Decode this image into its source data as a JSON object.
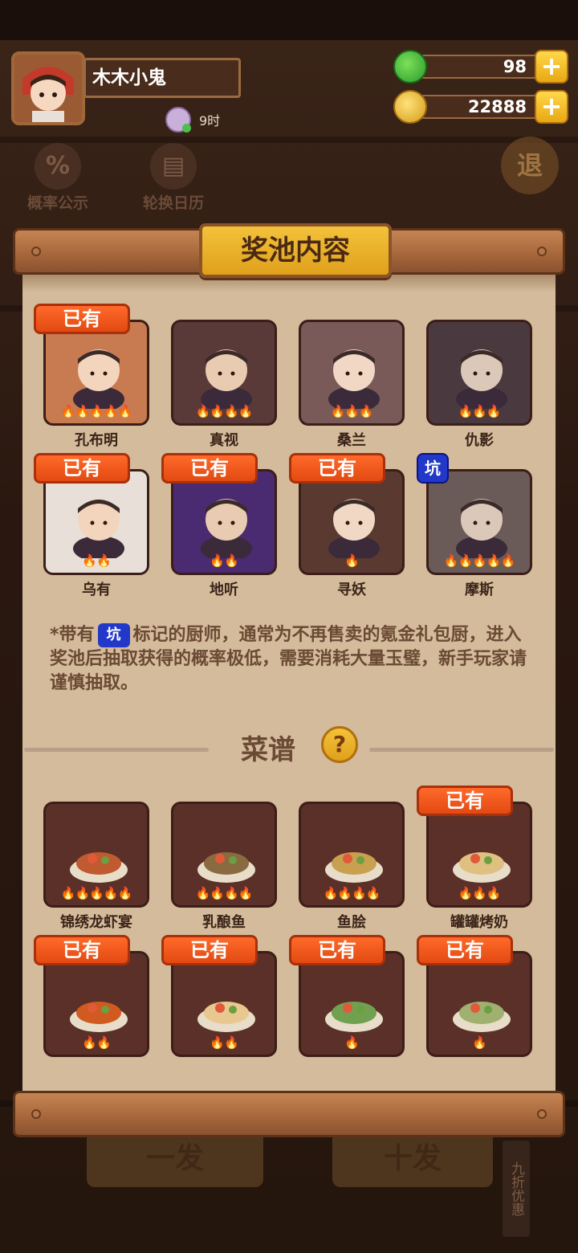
{
  "player": {
    "name": "木木小鬼",
    "time_label": "9时"
  },
  "currency": {
    "jade": "98",
    "coins": "22888",
    "plus_label": "+"
  },
  "background": {
    "tool_prob": "概率公示",
    "tool_calendar": "轮换日历",
    "exit_label": "退",
    "btn_one": "一发",
    "btn_ten": "十发",
    "side_label": "九折优惠"
  },
  "panel": {
    "title": "奖池内容",
    "owned_label": "已有",
    "pit_label": "坑",
    "chefs": [
      {
        "name": "孔布明",
        "owned": true,
        "stars": 5
      },
      {
        "name": "真视",
        "owned": false,
        "stars": 4
      },
      {
        "name": "桑兰",
        "owned": false,
        "stars": 3
      },
      {
        "name": "仇影",
        "owned": false,
        "stars": 3
      },
      {
        "name": "乌有",
        "owned": true,
        "stars": 2
      },
      {
        "name": "地听",
        "owned": true,
        "stars": 2
      },
      {
        "name": "寻妖",
        "owned": true,
        "stars": 1
      },
      {
        "name": "摩斯",
        "owned": false,
        "pit": true,
        "stars": 5
      }
    ],
    "note_prefix": "*带有",
    "note_text": "标记的厨师，通常为不再售卖的氪金礼包厨，进入奖池后抽取获得的概率极低，需要消耗大量玉璧，新手玩家请谨慎抽取。",
    "recipes_title": "菜谱",
    "help_label": "?",
    "recipes": [
      {
        "name": "锦绣龙虾宴",
        "owned": false,
        "stars": 5
      },
      {
        "name": "乳酿鱼",
        "owned": false,
        "stars": 4
      },
      {
        "name": "鱼脍",
        "owned": false,
        "stars": 4
      },
      {
        "name": "罐罐烤奶",
        "owned": true,
        "stars": 3
      },
      {
        "name": "",
        "owned": true,
        "stars": 2
      },
      {
        "name": "",
        "owned": true,
        "stars": 2
      },
      {
        "name": "",
        "owned": true,
        "stars": 1
      },
      {
        "name": "",
        "owned": true,
        "stars": 1
      }
    ]
  },
  "colors": {
    "owned_tag": "#e24a12",
    "pit_tag": "#2238c8",
    "paper": "#d4bb9b",
    "flame": "#ff7a1a"
  }
}
